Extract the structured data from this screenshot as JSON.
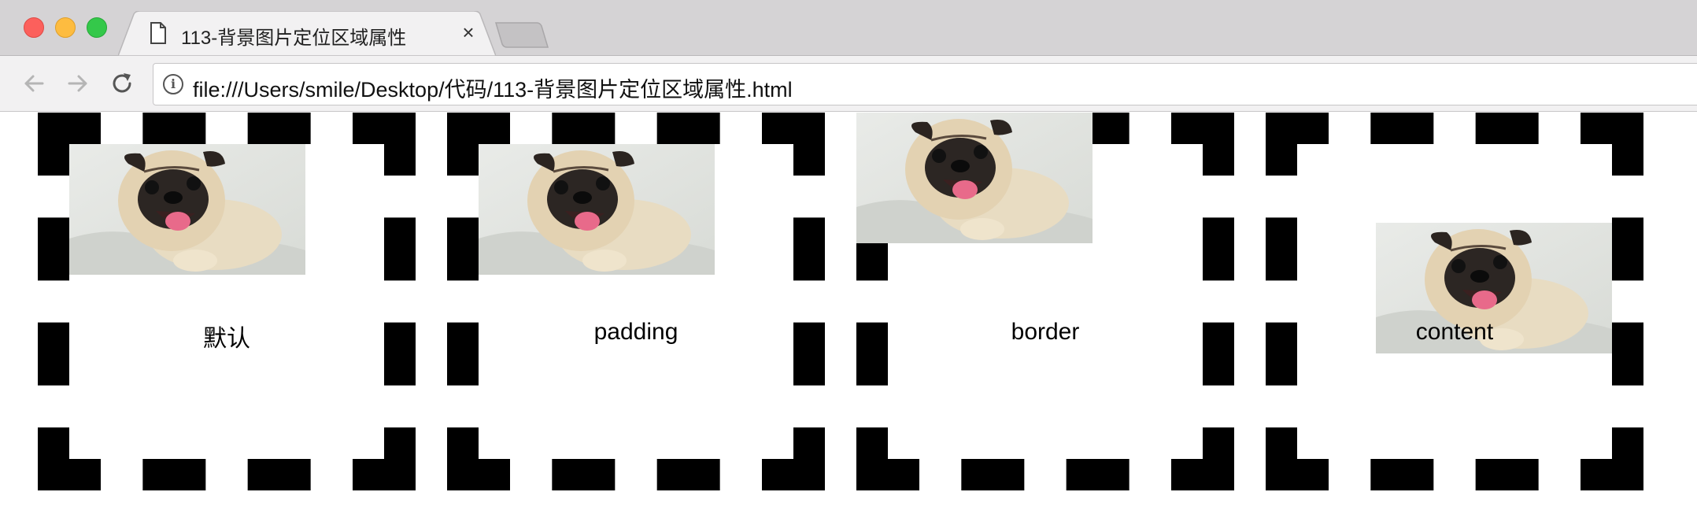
{
  "browser": {
    "tab_title": "113-背景图片定位区域属性",
    "tab_close_glyph": "×",
    "url": "file:///Users/smile/Desktop/代码/113-背景图片定位区域属性.html"
  },
  "icons": {
    "close": "traffic-close-icon",
    "minimize": "traffic-minimize-icon",
    "maximize": "traffic-maximize-icon",
    "page": "page-icon",
    "back": "back-arrow-icon",
    "forward": "forward-arrow-icon",
    "reload": "reload-icon",
    "info": "info-icon"
  },
  "colors": {
    "tabstrip": "#d5d3d5",
    "toolbar": "#f2f1f2",
    "border_dashes": "#000000"
  },
  "page": {
    "boxes": [
      {
        "label": "默认"
      },
      {
        "label": "padding"
      },
      {
        "label": "border"
      },
      {
        "label": "content"
      }
    ]
  }
}
